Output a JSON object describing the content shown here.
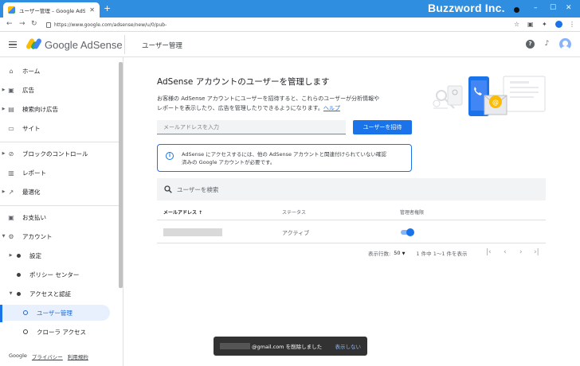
{
  "browser": {
    "tab_title": "ユーザー管理 – Google AdSense",
    "new_tab": "+",
    "brand_overlay": "Buzzword Inc.",
    "url": "https://www.google.com/adsense/new/u/0/pub-",
    "window": {
      "min": "–",
      "max": "☐",
      "close": "✕"
    }
  },
  "header": {
    "product": "Google AdSense",
    "page_title": "ユーザー管理",
    "help_icon": "?",
    "bell_icon": "bell-icon"
  },
  "sidebar": {
    "items": [
      {
        "label": "ホーム",
        "icon": "home-icon"
      },
      {
        "label": "広告",
        "icon": "ad-icon"
      },
      {
        "label": "検索向け広告",
        "icon": "search-ads-icon"
      },
      {
        "label": "サイト",
        "icon": "sites-icon"
      },
      {
        "label": "ブロックのコントロール",
        "icon": "block-icon"
      },
      {
        "label": "レポート",
        "icon": "report-icon"
      },
      {
        "label": "最適化",
        "icon": "optimize-icon"
      },
      {
        "label": "お支払い",
        "icon": "payments-icon"
      },
      {
        "label": "アカウント",
        "icon": "gear-icon"
      },
      {
        "label": "設定"
      },
      {
        "label": "ポリシー センター"
      },
      {
        "label": "アクセスと認証"
      },
      {
        "label": "ユーザー管理"
      },
      {
        "label": "クローラ アクセス"
      }
    ],
    "footer": {
      "google": "Google",
      "privacy": "プライバシー",
      "terms": "利用規約"
    }
  },
  "main": {
    "title": "AdSense アカウントのユーザーを管理します",
    "desc_line1": "お客様の AdSense アカウントにユーザーを招待すると、これらのユーザーが分析情報や",
    "desc_line2": "レポートを表示したり、広告を管理したりできるようになります。",
    "help_link": "ヘルプ",
    "email_placeholder": "メールアドレスを入力",
    "invite_button": "ユーザーを招待",
    "info_line1": "AdSense にアクセスするには、他の AdSense アカウントと関連付けられていない確認",
    "info_line2": "済みの Google アカウントが必要です。",
    "search_placeholder": "ユーザーを検索",
    "table": {
      "headers": {
        "email": "メールアドレス",
        "status": "ステータス",
        "admin": "管理者権限"
      },
      "sort_icon": "↑",
      "rows": [
        {
          "status": "アクティブ",
          "admin": true
        }
      ]
    },
    "pager": {
      "rows_label": "表示行数:",
      "rows_value": "50",
      "range": "1 件中 1～1 件を表示"
    }
  },
  "snackbar": {
    "message": "@gmail.com を削除しました",
    "action": "表示しない"
  },
  "colors": {
    "accent": "#1a73e8",
    "chrome": "#2f8ee0"
  }
}
